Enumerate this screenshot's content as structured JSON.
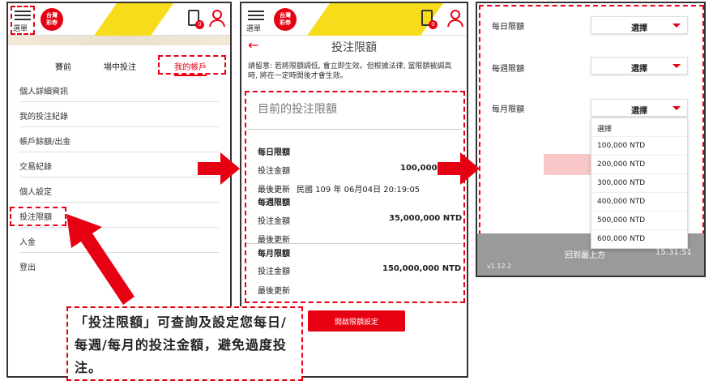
{
  "common": {
    "menu_label": "選單",
    "logo_text": "台灣\n彩券",
    "badge": "0"
  },
  "panel1": {
    "tabs": [
      "賽前",
      "場中投注",
      "我的帳戶"
    ],
    "menu": [
      "個人詳細資訊",
      "我的投注紀錄",
      "帳戶餘額/出金",
      "交易紀錄",
      "個人設定",
      "投注限額",
      "入金",
      "登出"
    ]
  },
  "panel2": {
    "title": "投注限額",
    "notice": "請留意: 若將限額調低, 會立即生效。但根據法律, 當限額被調高時, 將在一定時間後才會生效。",
    "current_title": "目前的投注限額",
    "daily": {
      "heading": "每日限額",
      "amount_label": "投注金額",
      "amount": "100,000",
      "updated_label": "最後更新",
      "updated": "民國 109 年 06月04日 20:19:05"
    },
    "weekly": {
      "heading": "每週限額",
      "amount_label": "投注金額",
      "amount": "35,000,000 NTD",
      "updated_label": "最後更新"
    },
    "monthly": {
      "heading": "每月限額",
      "amount_label": "投注金額",
      "amount": "150,000,000 NTD",
      "updated_label": "最後更新"
    },
    "button": "開啟限額設定"
  },
  "panel3": {
    "daily_label": "每日限額",
    "weekly_label": "每週限額",
    "monthly_label": "每月限額",
    "select_placeholder": "選擇",
    "options": [
      "選擇",
      "100,000 NTD",
      "200,000 NTD",
      "300,000 NTD",
      "400,000 NTD",
      "500,000 NTD",
      "600,000 NTD"
    ],
    "footer_text": "回到最上方",
    "time": "15:31:51",
    "version": "v1.12.2"
  },
  "callout": "「投注限額」可查詢及設定您每日/每週/每月的投注金額，避免過度投注。",
  "colors": {
    "accent": "#e60012",
    "stripe": "#f7dc1c",
    "dark": "#333333"
  }
}
